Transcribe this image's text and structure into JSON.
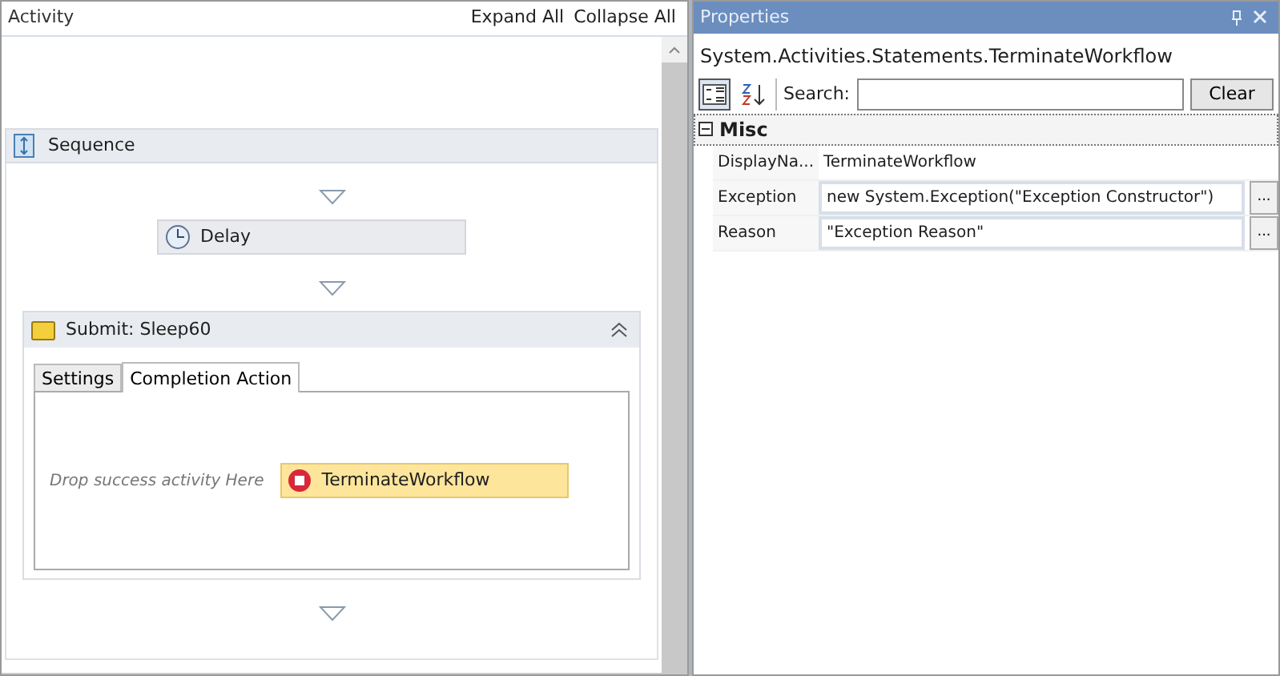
{
  "activity_panel": {
    "title": "Activity",
    "actions": [
      "Expand All",
      "Collapse All"
    ],
    "sequence": {
      "title": "Sequence",
      "activities": [
        {
          "kind": "activity",
          "title": "Delay"
        },
        {
          "kind": "container",
          "title": "Submit: Sleep60",
          "expanded": true,
          "tabs": [
            {
              "label": "Settings",
              "selected": false
            },
            {
              "label": "Completion Action",
              "selected": true
            }
          ],
          "drop_hint": "Drop success activity Here",
          "child": "TerminateWorkflow"
        }
      ]
    }
  },
  "properties": {
    "title": "Properties",
    "type_name": "System.Activities.Statements.TerminateWorkflow",
    "sort_buttons": [
      {
        "kind": "categorized",
        "selected": true
      },
      {
        "kind": "alphabetical",
        "selected": false
      }
    ],
    "search": {
      "label": "Search:"
    },
    "clear_button": "Clear",
    "category": {
      "title": "Misc",
      "expanded": true
    },
    "rows": [
      {
        "kind": "text",
        "name": "DisplayNa...",
        "value": "TerminateWorkflow"
      },
      {
        "kind": "expression",
        "name": "Exception",
        "value": "new System.Exception(\"Exception Constructor\")",
        "button": "..."
      },
      {
        "kind": "expression",
        "name": "Reason",
        "value": "\"Exception Reason\"",
        "button": "..."
      }
    ]
  }
}
